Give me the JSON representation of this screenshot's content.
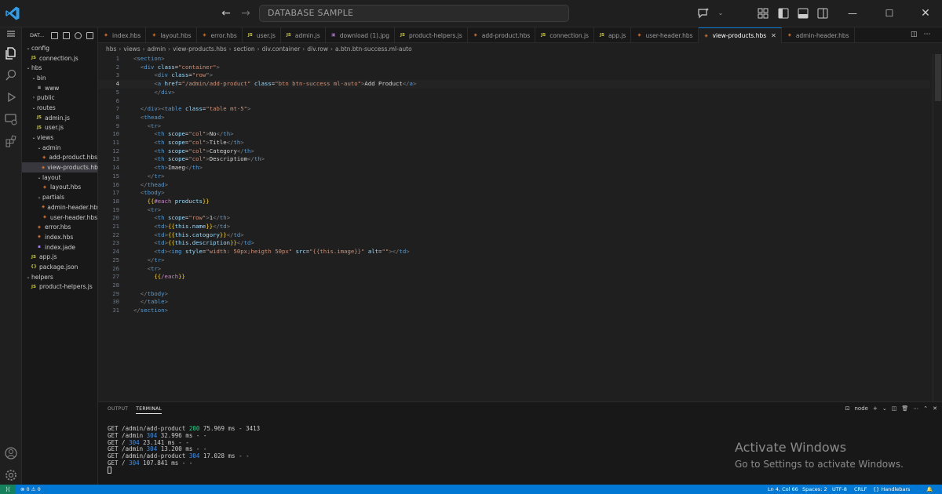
{
  "titlebar": {
    "search_text": "DATABASE SAMPLE"
  },
  "sidebar": {
    "header_label": "DAT...",
    "items": [
      {
        "label": "config",
        "type": "folder",
        "expanded": true,
        "depth": 0
      },
      {
        "label": "connection.js",
        "type": "js",
        "depth": 1
      },
      {
        "label": "hbs",
        "type": "folder",
        "expanded": true,
        "depth": 0
      },
      {
        "label": "bin",
        "type": "folder",
        "expanded": true,
        "depth": 1
      },
      {
        "label": "www",
        "type": "bin",
        "depth": 2
      },
      {
        "label": "public",
        "type": "folder",
        "expanded": false,
        "depth": 1
      },
      {
        "label": "routes",
        "type": "folder",
        "expanded": true,
        "depth": 1
      },
      {
        "label": "admin.js",
        "type": "js",
        "depth": 2
      },
      {
        "label": "user.js",
        "type": "js",
        "depth": 2
      },
      {
        "label": "views",
        "type": "folder",
        "expanded": true,
        "depth": 1
      },
      {
        "label": "admin",
        "type": "folder",
        "expanded": true,
        "depth": 2
      },
      {
        "label": "add-product.hbs",
        "type": "hbs",
        "depth": 3
      },
      {
        "label": "view-products.hbs",
        "type": "hbs",
        "depth": 3,
        "active": true
      },
      {
        "label": "layout",
        "type": "folder",
        "expanded": true,
        "depth": 2
      },
      {
        "label": "layout.hbs",
        "type": "hbs",
        "depth": 3
      },
      {
        "label": "partials",
        "type": "folder",
        "expanded": true,
        "depth": 2
      },
      {
        "label": "admin-header.hbs",
        "type": "hbs",
        "depth": 3
      },
      {
        "label": "user-header.hbs",
        "type": "hbs",
        "depth": 3
      },
      {
        "label": "error.hbs",
        "type": "hbs",
        "depth": 2
      },
      {
        "label": "index.hbs",
        "type": "hbs",
        "depth": 2
      },
      {
        "label": "index.jade",
        "type": "jade",
        "depth": 2
      },
      {
        "label": "app.js",
        "type": "js",
        "depth": 1
      },
      {
        "label": "package.json",
        "type": "json",
        "depth": 1
      },
      {
        "label": "helpers",
        "type": "folder",
        "expanded": true,
        "depth": 0
      },
      {
        "label": "product-helpers.js",
        "type": "js",
        "depth": 1
      }
    ]
  },
  "tabs": [
    {
      "label": "index.hbs",
      "type": "hbs"
    },
    {
      "label": "layout.hbs",
      "type": "hbs"
    },
    {
      "label": "error.hbs",
      "type": "hbs"
    },
    {
      "label": "user.js",
      "type": "js"
    },
    {
      "label": "admin.js",
      "type": "js"
    },
    {
      "label": "download (1).jpg",
      "type": "img"
    },
    {
      "label": "product-helpers.js",
      "type": "js"
    },
    {
      "label": "add-product.hbs",
      "type": "hbs"
    },
    {
      "label": "connection.js",
      "type": "js"
    },
    {
      "label": "app.js",
      "type": "js"
    },
    {
      "label": "user-header.hbs",
      "type": "hbs"
    },
    {
      "label": "view-products.hbs",
      "type": "hbs",
      "active": true
    },
    {
      "label": "admin-header.hbs",
      "type": "hbs"
    }
  ],
  "breadcrumb": [
    "hbs",
    "views",
    "admin",
    "view-products.hbs",
    "section",
    "div.container",
    "div.row",
    "a.btn.btn-success.ml-auto"
  ],
  "editor": {
    "current_line": 4,
    "lines": [
      [
        [
          "t-pun",
          "<"
        ],
        [
          "t-tag",
          "section"
        ],
        [
          "t-pun",
          ">"
        ]
      ],
      [
        [
          "",
          "  "
        ],
        [
          "t-pun",
          "<"
        ],
        [
          "t-tag",
          "div "
        ],
        [
          "t-attr",
          "class"
        ],
        [
          "t-txt",
          "="
        ],
        [
          "t-str",
          "\"container\""
        ],
        [
          "t-pun",
          ">"
        ]
      ],
      [
        [
          "",
          "      "
        ],
        [
          "t-pun",
          "<"
        ],
        [
          "t-tag",
          "div "
        ],
        [
          "t-attr",
          "class"
        ],
        [
          "t-txt",
          "="
        ],
        [
          "t-str",
          "\"row\""
        ],
        [
          "t-pun",
          ">"
        ]
      ],
      [
        [
          "",
          "      "
        ],
        [
          "t-pun",
          "<"
        ],
        [
          "t-tag",
          "a "
        ],
        [
          "t-attr",
          "href"
        ],
        [
          "t-txt",
          "="
        ],
        [
          "t-str",
          "\"/admin/add-product\" "
        ],
        [
          "t-attr",
          "class"
        ],
        [
          "t-txt",
          "="
        ],
        [
          "t-str",
          "\"btn btn-success ml-auto\""
        ],
        [
          "t-pun",
          ">"
        ],
        [
          "t-txt",
          "Add Product"
        ],
        [
          "t-pun",
          "</"
        ],
        [
          "t-tag",
          "a"
        ],
        [
          "t-pun",
          ">"
        ]
      ],
      [
        [
          "",
          "      "
        ],
        [
          "t-pun",
          "</"
        ],
        [
          "t-tag",
          "div"
        ],
        [
          "t-pun",
          ">"
        ]
      ],
      [
        [
          "",
          ""
        ]
      ],
      [
        [
          "",
          "  "
        ],
        [
          "t-pun",
          "</"
        ],
        [
          "t-tag",
          "div"
        ],
        [
          "t-pun",
          ">"
        ],
        [
          "t-pun",
          "<"
        ],
        [
          "t-tag",
          "table "
        ],
        [
          "t-attr",
          "class"
        ],
        [
          "t-txt",
          "="
        ],
        [
          "t-str",
          "\"table mt-5\""
        ],
        [
          "t-pun",
          ">"
        ]
      ],
      [
        [
          "",
          "  "
        ],
        [
          "t-pun",
          "<"
        ],
        [
          "t-tag",
          "thead"
        ],
        [
          "t-pun",
          ">"
        ]
      ],
      [
        [
          "",
          "    "
        ],
        [
          "t-pun",
          "<"
        ],
        [
          "t-tag",
          "tr"
        ],
        [
          "t-pun",
          ">"
        ]
      ],
      [
        [
          "",
          "      "
        ],
        [
          "t-pun",
          "<"
        ],
        [
          "t-tag",
          "th "
        ],
        [
          "t-attr",
          "scope"
        ],
        [
          "t-txt",
          "="
        ],
        [
          "t-str",
          "\"col\""
        ],
        [
          "t-pun",
          ">"
        ],
        [
          "t-txt",
          "No"
        ],
        [
          "t-pun",
          "</"
        ],
        [
          "t-tag",
          "th"
        ],
        [
          "t-pun",
          ">"
        ]
      ],
      [
        [
          "",
          "      "
        ],
        [
          "t-pun",
          "<"
        ],
        [
          "t-tag",
          "th "
        ],
        [
          "t-attr",
          "scope"
        ],
        [
          "t-txt",
          "="
        ],
        [
          "t-str",
          "\"col\""
        ],
        [
          "t-pun",
          ">"
        ],
        [
          "t-txt",
          "Title"
        ],
        [
          "t-pun",
          "</"
        ],
        [
          "t-tag",
          "th"
        ],
        [
          "t-pun",
          ">"
        ]
      ],
      [
        [
          "",
          "      "
        ],
        [
          "t-pun",
          "<"
        ],
        [
          "t-tag",
          "th "
        ],
        [
          "t-attr",
          "scope"
        ],
        [
          "t-txt",
          "="
        ],
        [
          "t-str",
          "\"col\""
        ],
        [
          "t-pun",
          ">"
        ],
        [
          "t-txt",
          "Category"
        ],
        [
          "t-pun",
          "</"
        ],
        [
          "t-tag",
          "th"
        ],
        [
          "t-pun",
          ">"
        ]
      ],
      [
        [
          "",
          "      "
        ],
        [
          "t-pun",
          "<"
        ],
        [
          "t-tag",
          "th "
        ],
        [
          "t-attr",
          "scope"
        ],
        [
          "t-txt",
          "="
        ],
        [
          "t-str",
          "\"col\""
        ],
        [
          "t-pun",
          ">"
        ],
        [
          "t-txt",
          "Descriptiom"
        ],
        [
          "t-pun",
          "</"
        ],
        [
          "t-tag",
          "th"
        ],
        [
          "t-pun",
          ">"
        ]
      ],
      [
        [
          "",
          "      "
        ],
        [
          "t-pun",
          "<"
        ],
        [
          "t-tag",
          "th"
        ],
        [
          "t-pun",
          ">"
        ],
        [
          "t-txt",
          "Imaeg"
        ],
        [
          "t-pun",
          "</"
        ],
        [
          "t-tag",
          "th"
        ],
        [
          "t-pun",
          ">"
        ]
      ],
      [
        [
          "",
          "    "
        ],
        [
          "t-pun",
          "</"
        ],
        [
          "t-tag",
          "tr"
        ],
        [
          "t-pun",
          ">"
        ]
      ],
      [
        [
          "",
          "  "
        ],
        [
          "t-pun",
          "</"
        ],
        [
          "t-tag",
          "thead"
        ],
        [
          "t-pun",
          ">"
        ]
      ],
      [
        [
          "",
          "  "
        ],
        [
          "t-pun",
          "<"
        ],
        [
          "t-tag",
          "tbody"
        ],
        [
          "t-pun",
          ">"
        ]
      ],
      [
        [
          "",
          "    "
        ],
        [
          "t-hb",
          "{{"
        ],
        [
          "t-hbk",
          "#each "
        ],
        [
          "t-var",
          "products"
        ],
        [
          "t-hb",
          "}}"
        ]
      ],
      [
        [
          "",
          "    "
        ],
        [
          "t-pun",
          "<"
        ],
        [
          "t-tag",
          "tr"
        ],
        [
          "t-pun",
          ">"
        ]
      ],
      [
        [
          "",
          "      "
        ],
        [
          "t-pun",
          "<"
        ],
        [
          "t-tag",
          "th "
        ],
        [
          "t-attr",
          "scope"
        ],
        [
          "t-txt",
          "="
        ],
        [
          "t-str",
          "\"row\""
        ],
        [
          "t-pun",
          ">"
        ],
        [
          "t-txt",
          "1"
        ],
        [
          "t-pun",
          "</"
        ],
        [
          "t-tag",
          "th"
        ],
        [
          "t-pun",
          ">"
        ]
      ],
      [
        [
          "",
          "      "
        ],
        [
          "t-pun",
          "<"
        ],
        [
          "t-tag",
          "td"
        ],
        [
          "t-pun",
          ">"
        ],
        [
          "t-hb",
          "{{"
        ],
        [
          "t-var",
          "this.name"
        ],
        [
          "t-hb",
          "}}"
        ],
        [
          "t-pun",
          "</"
        ],
        [
          "t-tag",
          "td"
        ],
        [
          "t-pun",
          ">"
        ]
      ],
      [
        [
          "",
          "      "
        ],
        [
          "t-pun",
          "<"
        ],
        [
          "t-tag",
          "td"
        ],
        [
          "t-pun",
          ">"
        ],
        [
          "t-hb",
          "{{"
        ],
        [
          "t-var",
          "this.catogory"
        ],
        [
          "t-hb",
          "}}"
        ],
        [
          "t-pun",
          "</"
        ],
        [
          "t-tag",
          "td"
        ],
        [
          "t-pun",
          ">"
        ]
      ],
      [
        [
          "",
          "      "
        ],
        [
          "t-pun",
          "<"
        ],
        [
          "t-tag",
          "td"
        ],
        [
          "t-pun",
          ">"
        ],
        [
          "t-hb",
          "{{"
        ],
        [
          "t-var",
          "this.description"
        ],
        [
          "t-hb",
          "}}"
        ],
        [
          "t-pun",
          "</"
        ],
        [
          "t-tag",
          "td"
        ],
        [
          "t-pun",
          ">"
        ]
      ],
      [
        [
          "",
          "      "
        ],
        [
          "t-pun",
          "<"
        ],
        [
          "t-tag",
          "td"
        ],
        [
          "t-pun",
          ">"
        ],
        [
          "t-pun",
          "<"
        ],
        [
          "t-tag",
          "img "
        ],
        [
          "t-attr",
          "style"
        ],
        [
          "t-txt",
          "="
        ],
        [
          "t-str",
          "\"width: 50px;heigth 50px\" "
        ],
        [
          "t-attr",
          "src"
        ],
        [
          "t-txt",
          "="
        ],
        [
          "t-str",
          "\"{{this.image}}\" "
        ],
        [
          "t-attr",
          "alt"
        ],
        [
          "t-txt",
          "="
        ],
        [
          "t-str",
          "\"\""
        ],
        [
          "t-pun",
          "></"
        ],
        [
          "t-tag",
          "td"
        ],
        [
          "t-pun",
          ">"
        ]
      ],
      [
        [
          "",
          "    "
        ],
        [
          "t-pun",
          "</"
        ],
        [
          "t-tag",
          "tr"
        ],
        [
          "t-pun",
          ">"
        ]
      ],
      [
        [
          "",
          "    "
        ],
        [
          "t-pun",
          "<"
        ],
        [
          "t-tag",
          "tr"
        ],
        [
          "t-pun",
          ">"
        ]
      ],
      [
        [
          "",
          "      "
        ],
        [
          "t-hb",
          "{{"
        ],
        [
          "t-hbk",
          "/each"
        ],
        [
          "t-hb",
          "}}"
        ]
      ],
      [
        [
          "",
          ""
        ]
      ],
      [
        [
          "",
          "  "
        ],
        [
          "t-pun",
          "</"
        ],
        [
          "t-tag",
          "tbody"
        ],
        [
          "t-pun",
          ">"
        ]
      ],
      [
        [
          "",
          "  "
        ],
        [
          "t-pun",
          "</"
        ],
        [
          "t-tag",
          "table"
        ],
        [
          "t-pun",
          ">"
        ]
      ],
      [
        [
          "t-pun",
          "</"
        ],
        [
          "t-tag",
          "section"
        ],
        [
          "t-pun",
          ">"
        ]
      ]
    ]
  },
  "panel": {
    "tabs": [
      {
        "label": "OUTPUT",
        "active": false
      },
      {
        "label": "TERMINAL",
        "active": true
      }
    ],
    "shell_label": "node",
    "terminal_lines": [
      {
        "pre": "GET /admin/add-product ",
        "status": "200",
        "post": " 75.969 ms - 3413"
      },
      {
        "pre": "GET /admin ",
        "status": "304",
        "post": " 32.996 ms - -"
      },
      {
        "pre": "GET / ",
        "status": "304",
        "post": " 23.141 ms - -"
      },
      {
        "pre": "GET /admin ",
        "status": "304",
        "post": " 13.200 ms - -"
      },
      {
        "pre": "GET /admin/add-product ",
        "status": "304",
        "post": " 17.028 ms - -"
      },
      {
        "pre": "GET / ",
        "status": "304",
        "post": " 107.841 ms - -"
      }
    ]
  },
  "watermark": {
    "line1": "Activate Windows",
    "line2": "Go to Settings to activate Windows."
  },
  "statusbar": {
    "problems": "⊗ 0 ⚠ 0",
    "cursor": "Ln 4, Col 66",
    "spaces": "Spaces: 2",
    "encoding": "UTF-8",
    "eol": "CRLF",
    "language": "{} Handlebars"
  },
  "colors": {
    "accent": "#0078d4",
    "status_200": "#23d18b",
    "status_304": "#3b8eea"
  }
}
